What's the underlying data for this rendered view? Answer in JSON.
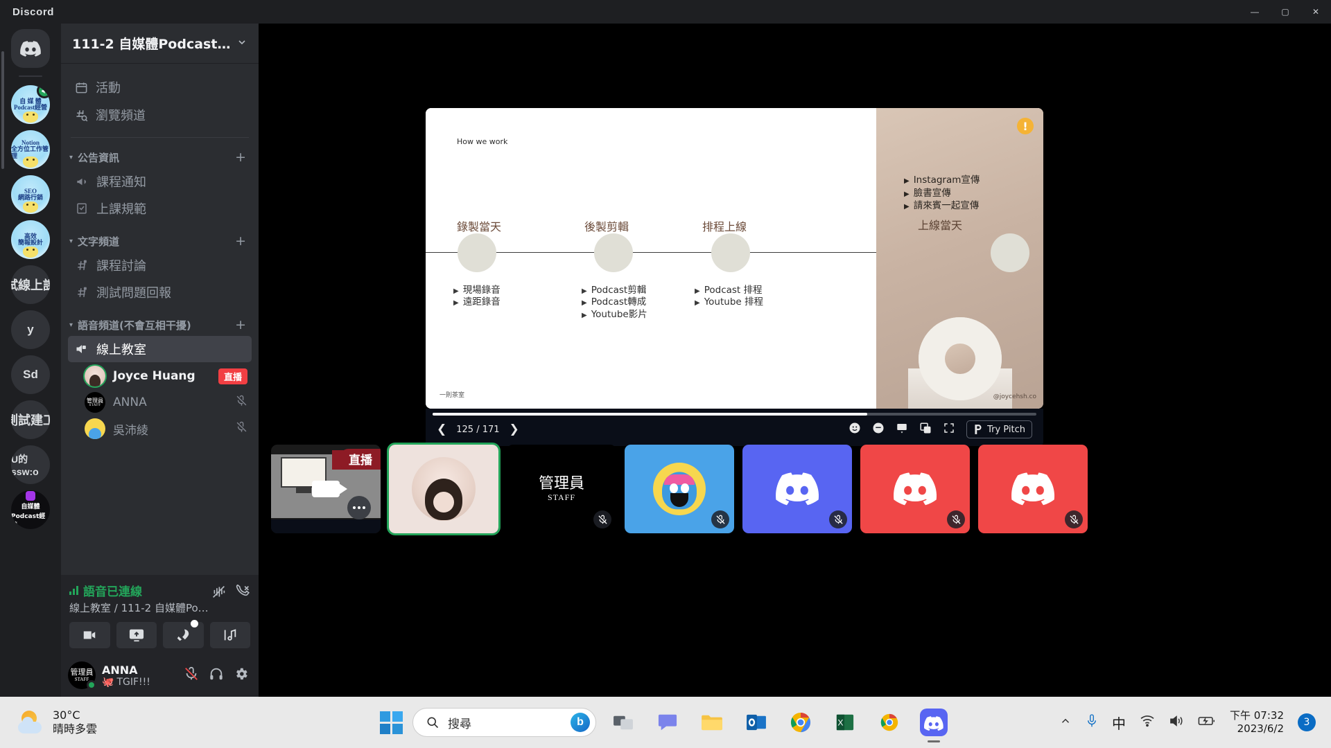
{
  "window": {
    "app_title": "Discord",
    "minimize": "—",
    "maximize": "▢",
    "close": "✕"
  },
  "server_rail": {
    "home_icon": "discord-home-icon",
    "servers": [
      {
        "name": "自媒體Podcast經營",
        "line1": "自 媒 體",
        "line2": "Podcast經營",
        "type": "image",
        "selected": true,
        "voice_active": true
      },
      {
        "name": "Notion全方位工作管理",
        "line1": "Notion",
        "line2": "全方位工作管理",
        "type": "image",
        "selected": false,
        "voice_active": false
      },
      {
        "name": "SEO網路行銷",
        "line1": "SEO",
        "line2": "網路行銷",
        "type": "image",
        "selected": false,
        "voice_active": false
      },
      {
        "name": "高效簡報設計",
        "line1": "高效",
        "line2": "簡報設計",
        "type": "image",
        "selected": false,
        "voice_active": false
      },
      {
        "name": "試線上課",
        "label": "試線上課",
        "type": "text",
        "selected": false,
        "voice_active": false
      },
      {
        "name": "y",
        "label": "y",
        "type": "text",
        "selected": false,
        "voice_active": false
      },
      {
        "name": "Sd",
        "label": "Sd",
        "type": "text",
        "selected": false,
        "voice_active": false
      },
      {
        "name": "測試建工",
        "label": "測試建工",
        "type": "text",
        "selected": false,
        "voice_active": false
      },
      {
        "name": "U的ssw:o",
        "label": "U的ssw:o",
        "type": "text",
        "selected": false,
        "voice_active": false
      },
      {
        "name": "自媒體Podcast經營 dark",
        "line1": "自媒體",
        "line2": "Podcast經營",
        "type": "dark",
        "selected": false,
        "voice_active": false
      }
    ]
  },
  "sidebar": {
    "guild_name": "111-2 自媒體Podcast經...",
    "guild_chevron": "chevron-down-icon",
    "nav": [
      {
        "label": "活動",
        "icon": "calendar-icon"
      },
      {
        "label": "瀏覽頻道",
        "icon": "browse-channels-icon"
      }
    ],
    "categories": [
      {
        "label": "公告資訊",
        "add_label": "+",
        "channels": [
          {
            "label": "課程通知",
            "icon": "announcement-icon",
            "active": false
          },
          {
            "label": "上課規範",
            "icon": "rules-icon",
            "active": false
          }
        ]
      },
      {
        "label": "文字頻道",
        "add_label": "+",
        "channels": [
          {
            "label": "課程討論",
            "icon": "hash-lock-icon",
            "active": false
          },
          {
            "label": "測試問題回報",
            "icon": "hash-lock-icon",
            "active": false
          }
        ]
      },
      {
        "label": "語音頻道(不會互相干擾)",
        "add_label": "+",
        "channels": [
          {
            "label": "線上教室",
            "icon": "speaker-lock-icon",
            "active": true
          }
        ]
      }
    ],
    "voice_members": [
      {
        "name": "Joyce Huang",
        "avatar": "joyce",
        "live": true,
        "live_tag": "直播",
        "muted": false
      },
      {
        "name": "ANNA",
        "avatar": "staff",
        "staff_line1": "管理員",
        "staff_line2": "STAFF",
        "live": false,
        "muted": true
      },
      {
        "name": "吳沛綾",
        "avatar": "blue",
        "live": false,
        "muted": true
      }
    ]
  },
  "voice_panel": {
    "status": "語音已連線",
    "route": "線上教室 / 111-2 自媒體Pod...",
    "signal_icon": "signal-bars-icon",
    "noise_icon": "noise-suppression-icon",
    "disconnect_icon": "disconnect-call-icon",
    "buttons": [
      {
        "name": "video-button",
        "icon": "camera-icon"
      },
      {
        "name": "screen-share-button",
        "icon": "screen-share-icon"
      },
      {
        "name": "activities-button",
        "icon": "rocket-icon",
        "has_dot": true
      },
      {
        "name": "soundboard-button",
        "icon": "soundboard-icon"
      }
    ]
  },
  "user_bar": {
    "name": "ANNA",
    "status_text": "TGIF!!!",
    "status_emoji": "🐙",
    "avatar_line1": "管理員",
    "avatar_line2": "STAFF",
    "actions": [
      {
        "name": "mic-muted-icon"
      },
      {
        "name": "headphones-icon"
      },
      {
        "name": "gear-icon"
      }
    ]
  },
  "slide": {
    "header": "How we work",
    "brand": "一則茶室",
    "handle": "@joycehsh.co",
    "warn_badge": "!",
    "timeline": [
      {
        "title": "錄製當天",
        "items": [
          "現場錄音",
          "遠距錄音"
        ]
      },
      {
        "title": "後製剪輯",
        "items": [
          "Podcast剪輯",
          "Podcast轉成",
          "Youtube影片"
        ]
      },
      {
        "title": "排程上線",
        "items": [
          "Podcast 排程",
          "Youtube 排程"
        ]
      }
    ],
    "right_panel": {
      "title": "上線當天",
      "items": [
        "Instagram宣傳",
        "臉書宣傳",
        "請來賓一起宣傳"
      ]
    }
  },
  "player": {
    "page_current": "125",
    "page_total": "171",
    "page_display": "125 / 171",
    "prev_icon": "chevron-left-icon",
    "next_icon": "chevron-right-icon",
    "try_pitch_label": "Try Pitch",
    "controls": [
      {
        "name": "reaction-icon"
      },
      {
        "name": "comment-icon"
      },
      {
        "name": "presenter-view-icon"
      },
      {
        "name": "duplicate-icon"
      },
      {
        "name": "fullscreen-icon"
      }
    ]
  },
  "participants": [
    {
      "name": "screen-share",
      "type": "screenshare",
      "live_tag": "直播",
      "muted": false,
      "selected": false
    },
    {
      "name": "Joyce Huang",
      "type": "photo",
      "muted": false,
      "selected": true
    },
    {
      "name": "ANNA",
      "type": "staff",
      "line1": "管理員",
      "line2": "STAFF",
      "muted": true,
      "selected": false
    },
    {
      "name": "wumpus",
      "type": "wumpus",
      "muted": true,
      "selected": false
    },
    {
      "name": "discord-purple",
      "type": "discord",
      "color": "#5865f2",
      "muted": true,
      "selected": false
    },
    {
      "name": "discord-red-1",
      "type": "discord",
      "color": "#f04747",
      "muted": true,
      "selected": false
    },
    {
      "name": "discord-red-2",
      "type": "discord",
      "color": "#f04747",
      "muted": true,
      "selected": false
    }
  ],
  "taskbar": {
    "weather_temp": "30°C",
    "weather_desc": "晴時多雲",
    "search_placeholder": "搜尋",
    "start_icon": "windows-start-icon",
    "apps": [
      {
        "name": "task-view-icon"
      },
      {
        "name": "chat-icon"
      },
      {
        "name": "file-explorer-icon"
      },
      {
        "name": "outlook-icon"
      },
      {
        "name": "chrome-icon"
      },
      {
        "name": "excel-icon"
      },
      {
        "name": "chrome-beta-icon"
      },
      {
        "name": "discord-icon",
        "active": true
      }
    ],
    "tray": {
      "overflow_icon": "chevron-up-icon",
      "mic_icon": "microphone-icon",
      "ime": "中",
      "wifi_icon": "wifi-icon",
      "volume_icon": "volume-icon",
      "battery_icon": "battery-charging-icon"
    },
    "time": "下午 07:32",
    "date": "2023/6/2",
    "notification_count": "3"
  },
  "colors": {
    "discord_blurple": "#5865f2",
    "online_green": "#23a55a",
    "live_red": "#f23f43",
    "sidebar_bg": "#2b2d31",
    "rail_bg": "#1e1f22"
  }
}
